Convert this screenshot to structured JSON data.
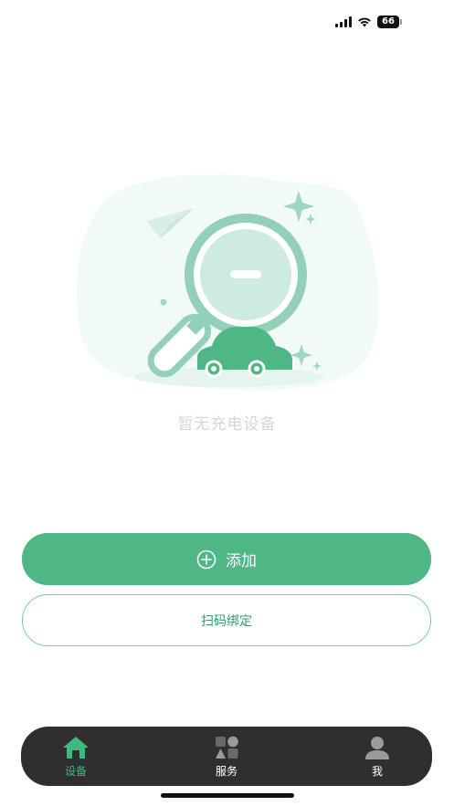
{
  "status_bar": {
    "battery_level": "66"
  },
  "empty_state": {
    "message": "暂无充电设备",
    "illustration_icon": "magnifier-car-icon"
  },
  "actions": {
    "add_label": "添加",
    "scan_bind_label": "扫码绑定"
  },
  "tab_bar": {
    "tabs": [
      {
        "label": "设备",
        "icon": "home-icon",
        "active": true
      },
      {
        "label": "服务",
        "icon": "services-icon",
        "active": false
      },
      {
        "label": "我",
        "icon": "profile-icon",
        "active": false
      }
    ]
  },
  "colors": {
    "accent": "#4fb686",
    "tab_bar_bg": "#2f2f2f",
    "active_tab": "#3fba7f",
    "empty_text": "#d4d6d8"
  }
}
